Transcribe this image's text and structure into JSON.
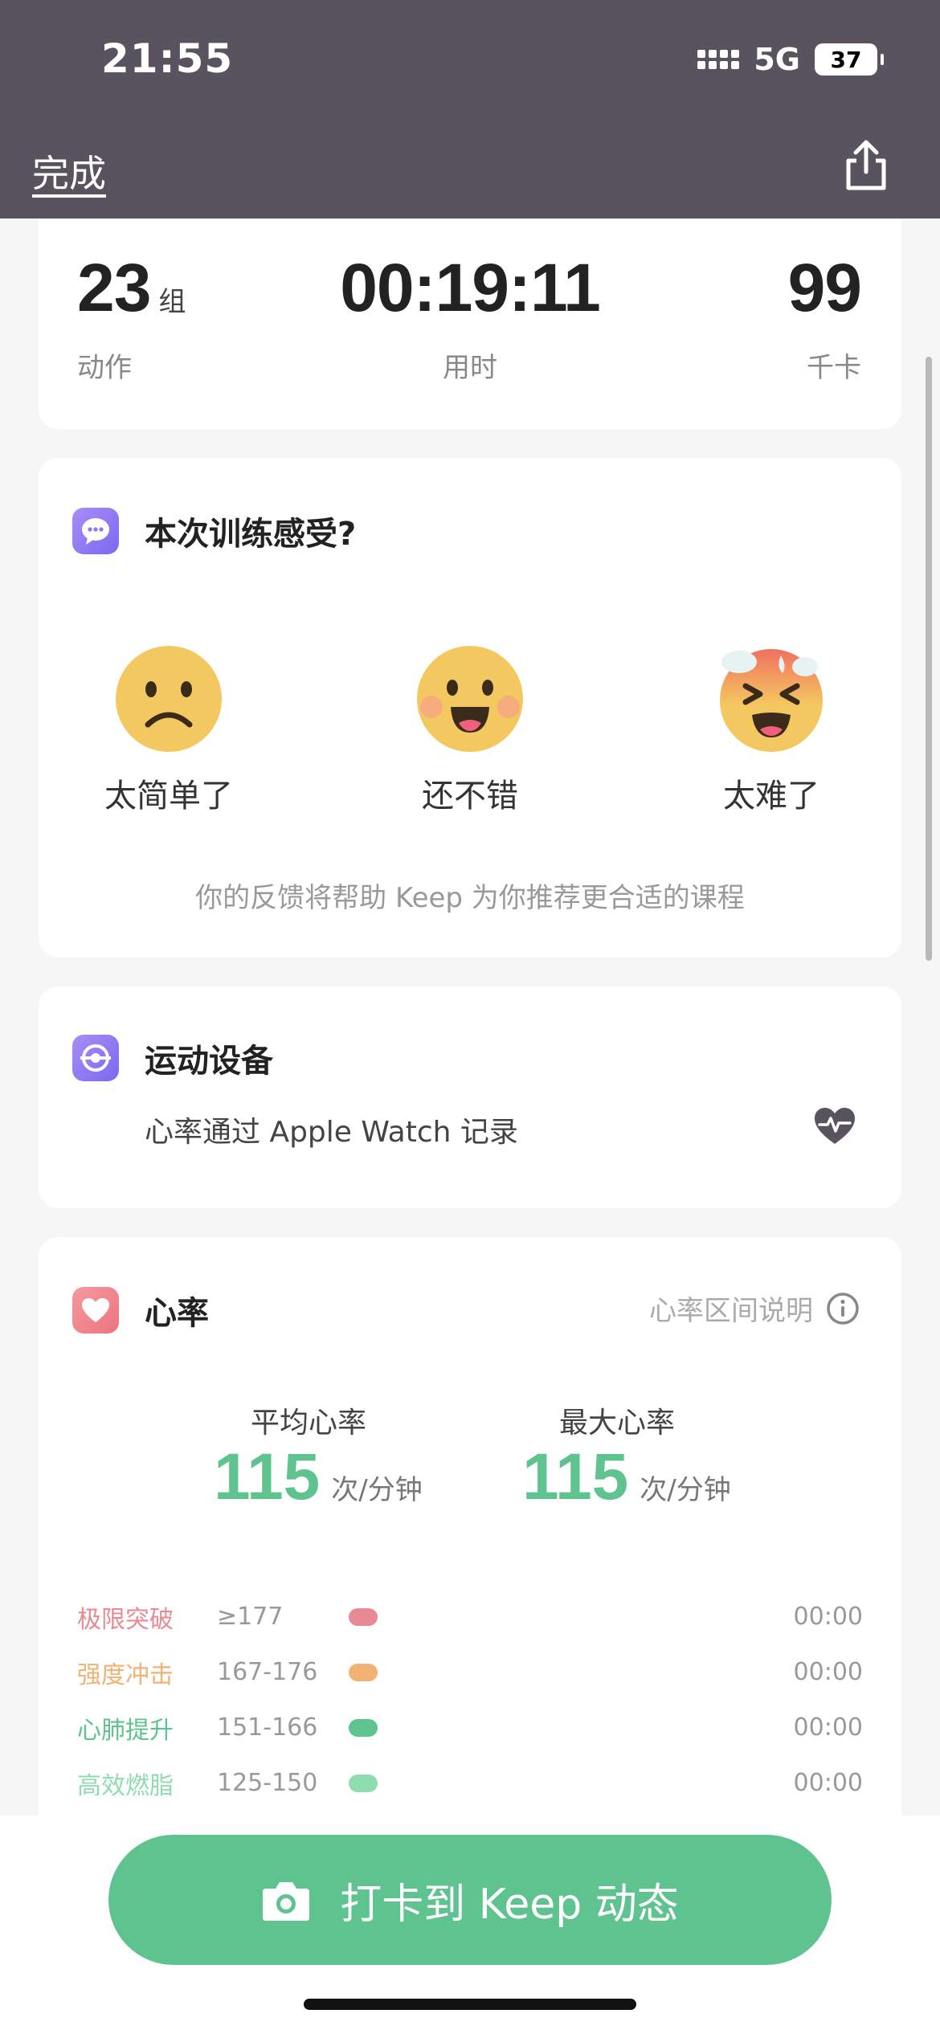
{
  "status_bar": {
    "time": "21:55",
    "network": "5G",
    "battery": "37"
  },
  "header": {
    "done_label": "完成",
    "share_icon": "share-icon"
  },
  "summary": {
    "groups": {
      "value": "23",
      "unit": "组",
      "label": "动作"
    },
    "duration": {
      "value": "00:19:11",
      "label": "用时"
    },
    "calories": {
      "value": "99",
      "label": "千卡"
    }
  },
  "feedback": {
    "title": "本次训练感受?",
    "options": [
      {
        "label": "太简单了",
        "icon": "sad-face-icon"
      },
      {
        "label": "还不错",
        "icon": "happy-face-icon"
      },
      {
        "label": "太难了",
        "icon": "exhausted-face-icon"
      }
    ],
    "note": "你的反馈将帮助 Keep 为你推荐更合适的课程"
  },
  "device": {
    "title": "运动设备",
    "description": "心率通过 Apple Watch 记录",
    "icon": "heart-pulse-icon"
  },
  "heart_rate": {
    "title": "心率",
    "help_label": "心率区间说明",
    "average": {
      "label": "平均心率",
      "value": "115",
      "unit": "次/分钟"
    },
    "max": {
      "label": "最大心率",
      "value": "115",
      "unit": "次/分钟"
    },
    "zones": [
      {
        "name": "极限突破",
        "range": "≥177",
        "time": "00:00",
        "color": "#e88a94"
      },
      {
        "name": "强度冲击",
        "range": "167-176",
        "time": "00:00",
        "color": "#f2b274"
      },
      {
        "name": "心肺提升",
        "range": "151-166",
        "time": "00:00",
        "color": "#5ec38e"
      },
      {
        "name": "高效燃脂",
        "range": "125-150",
        "time": "00:00",
        "color": "#8fdcb1"
      }
    ]
  },
  "checkin": {
    "label": "打卡到 Keep 动态",
    "icon": "camera-icon"
  },
  "colors": {
    "header_bg": "#58535f",
    "accent_green": "#5ec38e"
  }
}
